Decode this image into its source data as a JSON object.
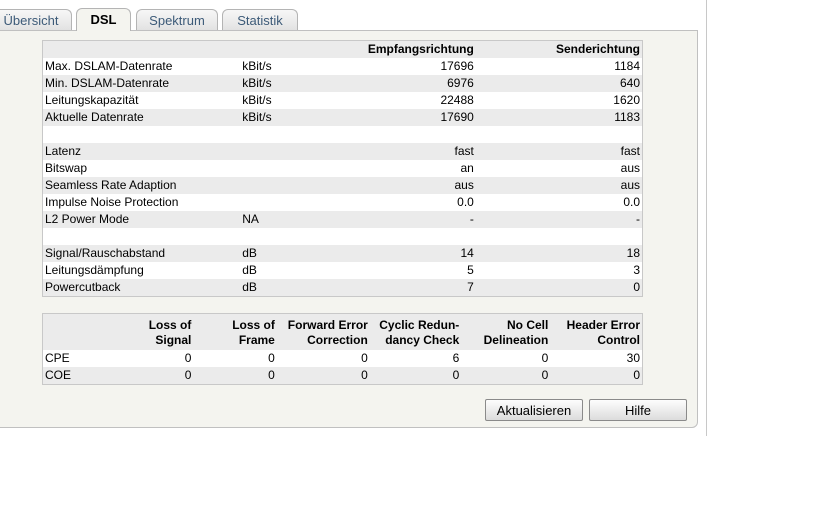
{
  "tabs": [
    {
      "label": "Übersicht",
      "active": false
    },
    {
      "label": "DSL",
      "active": true
    },
    {
      "label": "Spektrum",
      "active": false
    },
    {
      "label": "Statistik",
      "active": false
    }
  ],
  "dsl_table": {
    "headers": {
      "col1": "",
      "col2": "",
      "col3": "Empfangsrichtung",
      "col4": "Senderichtung"
    },
    "rows": [
      {
        "label": "Max. DSLAM-Datenrate",
        "unit": "kBit/s",
        "rx": "17696",
        "tx": "1184"
      },
      {
        "label": "Min. DSLAM-Datenrate",
        "unit": "kBit/s",
        "rx": "6976",
        "tx": "640"
      },
      {
        "label": "Leitungskapazität",
        "unit": "kBit/s",
        "rx": "22488",
        "tx": "1620"
      },
      {
        "label": "Aktuelle Datenrate",
        "unit": "kBit/s",
        "rx": "17690",
        "tx": "1183"
      },
      {
        "label": "",
        "unit": "",
        "rx": "",
        "tx": ""
      },
      {
        "label": "Latenz",
        "unit": "",
        "rx": "fast",
        "tx": "fast"
      },
      {
        "label": "Bitswap",
        "unit": "",
        "rx": "an",
        "tx": "aus"
      },
      {
        "label": "Seamless Rate Adaption",
        "unit": "",
        "rx": "aus",
        "tx": "aus"
      },
      {
        "label": "Impulse Noise Protection",
        "unit": "",
        "rx": "0.0",
        "tx": "0.0"
      },
      {
        "label": "L2 Power Mode",
        "unit": "NA",
        "rx": "-",
        "tx": "-"
      },
      {
        "label": "",
        "unit": "",
        "rx": "",
        "tx": ""
      },
      {
        "label": "Signal/Rauschabstand",
        "unit": "dB",
        "rx": "14",
        "tx": "18"
      },
      {
        "label": "Leitungsdämpfung",
        "unit": "dB",
        "rx": "5",
        "tx": "3"
      },
      {
        "label": "Powercutback",
        "unit": "dB",
        "rx": "7",
        "tx": "0"
      }
    ]
  },
  "error_table": {
    "headers": [
      {
        "line1": "",
        "line2": ""
      },
      {
        "line1": "Loss of",
        "line2": "Signal"
      },
      {
        "line1": "Loss of",
        "line2": "Frame"
      },
      {
        "line1": "Forward Error",
        "line2": "Correction"
      },
      {
        "line1": "Cyclic Redun-",
        "line2": "dancy Check"
      },
      {
        "line1": "No Cell",
        "line2": "Delineation"
      },
      {
        "line1": "Header Error",
        "line2": "Control"
      }
    ],
    "rows": [
      {
        "label": "CPE",
        "values": [
          "0",
          "0",
          "0",
          "6",
          "0",
          "30"
        ]
      },
      {
        "label": "COE",
        "values": [
          "0",
          "0",
          "0",
          "0",
          "0",
          "0"
        ]
      }
    ]
  },
  "buttons": {
    "refresh_label": "Aktualisieren",
    "help_label": "Hilfe"
  }
}
